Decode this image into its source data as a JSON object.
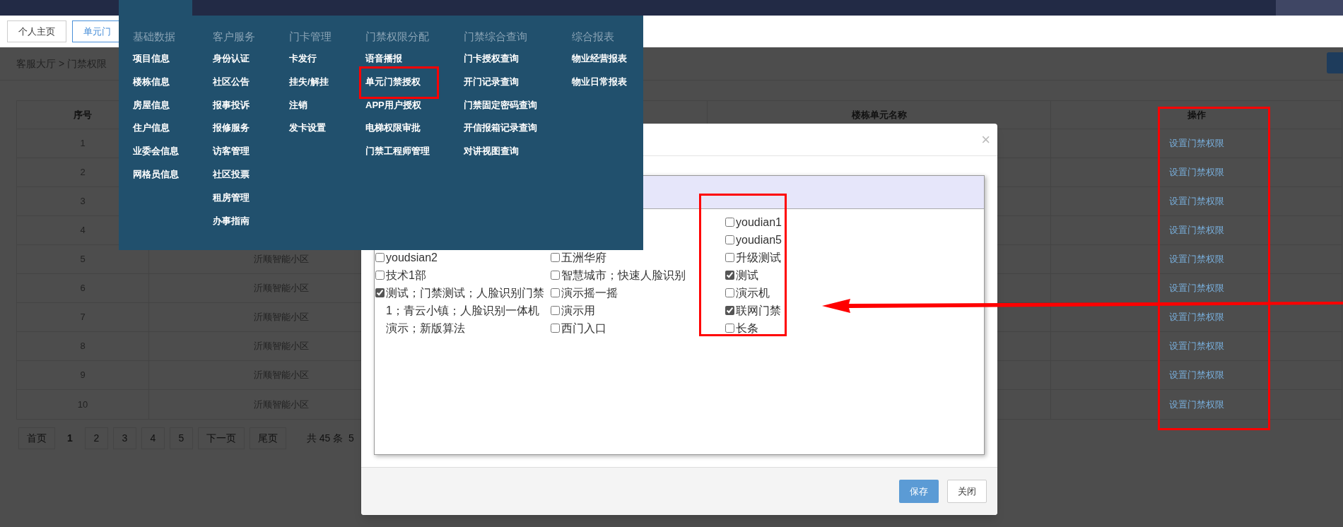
{
  "tabs": [
    {
      "label": "个人主页",
      "selected": false
    },
    {
      "label": "单元门",
      "selected": true
    }
  ],
  "breadcrumb": "客服大厅 > 门禁权限",
  "mega_menu": {
    "columns": [
      {
        "title": "基础数据",
        "items": [
          "项目信息",
          "楼栋信息",
          "房屋信息",
          "住户信息",
          "业委会信息",
          "网格员信息"
        ]
      },
      {
        "title": "客户服务",
        "items": [
          "身份认证",
          "社区公告",
          "报事投诉",
          "报修服务",
          "访客管理",
          "社区投票",
          "租房管理",
          "办事指南"
        ]
      },
      {
        "title": "门卡管理",
        "items": [
          "卡发行",
          "挂失/解挂",
          "注销",
          "发卡设置"
        ]
      },
      {
        "title": "门禁权限分配",
        "items": [
          "语音播报",
          "单元门禁授权",
          "APP用户授权",
          "电梯权限审批",
          "门禁工程师管理"
        ]
      },
      {
        "title": "门禁综合查询",
        "items": [
          "门卡授权查询",
          "开门记录查询",
          "门禁固定密码查询",
          "开信报箱记录查询",
          "对讲视图查询"
        ]
      },
      {
        "title": "综合报表",
        "items": [
          "物业经营报表",
          "物业日常报表"
        ]
      }
    ]
  },
  "table": {
    "column_1": "序号",
    "column_4": "楼栋单元名称",
    "column_5": "操作",
    "rows": [
      {
        "index": "1",
        "action": "设置门禁权限"
      },
      {
        "index": "2",
        "action": "设置门禁权限"
      },
      {
        "index": "3",
        "action": "设置门禁权限"
      },
      {
        "index": "4",
        "action": "设置门禁权限"
      },
      {
        "index": "5",
        "column_2": "沂顺智能小区",
        "action": "设置门禁权限"
      },
      {
        "index": "6",
        "column_2": "沂顺智能小区",
        "action": "设置门禁权限"
      },
      {
        "index": "7",
        "column_2": "沂顺智能小区",
        "action": "设置门禁权限"
      },
      {
        "index": "8",
        "column_2": "沂顺智能小区",
        "action": "设置门禁权限"
      },
      {
        "index": "9",
        "column_2": "沂顺智能小区",
        "action": "设置门禁权限"
      },
      {
        "index": "10",
        "column_2": "沂顺智能小区",
        "action": "设置门禁权限"
      }
    ]
  },
  "pagination": {
    "buttons": [
      {
        "label": "首页",
        "selected": false
      },
      {
        "label": "1",
        "selected": true
      },
      {
        "label": "2",
        "selected": false
      },
      {
        "label": "3",
        "selected": false
      },
      {
        "label": "4",
        "selected": false
      },
      {
        "label": "5",
        "selected": false
      },
      {
        "label": "下一页",
        "selected": false
      },
      {
        "label": "尾页",
        "selected": false
      }
    ],
    "summary": "共 45 条  5"
  },
  "modal": {
    "close": "×",
    "columns": [
      [
        {
          "label": "youdsian2",
          "checked": false
        },
        {
          "label": "技术1部",
          "checked": false
        },
        {
          "label": "测试；门禁测试；人脸识别门禁1；青云小镇；人脸识别一体机演示；新版算法",
          "checked": true
        }
      ],
      [
        {
          "label": "五洲华府",
          "checked": false
        },
        {
          "label": "智慧城市；快速人脸识别",
          "checked": false
        },
        {
          "label": "演示摇一摇",
          "checked": false
        },
        {
          "label": "演示用",
          "checked": false
        },
        {
          "label": "西门入口",
          "checked": false
        }
      ],
      [
        {
          "label": "youdian1",
          "checked": false
        },
        {
          "label": "youdian5",
          "checked": false
        },
        {
          "label": "升级测试",
          "checked": false
        },
        {
          "label": "测试",
          "checked": true
        },
        {
          "label": "演示机",
          "checked": false
        },
        {
          "label": "联网门禁",
          "checked": true
        },
        {
          "label": "长条",
          "checked": false
        }
      ]
    ],
    "buttons": [
      {
        "label": "保存",
        "kind": "primary"
      },
      {
        "label": "关闭",
        "kind": "default"
      }
    ]
  }
}
